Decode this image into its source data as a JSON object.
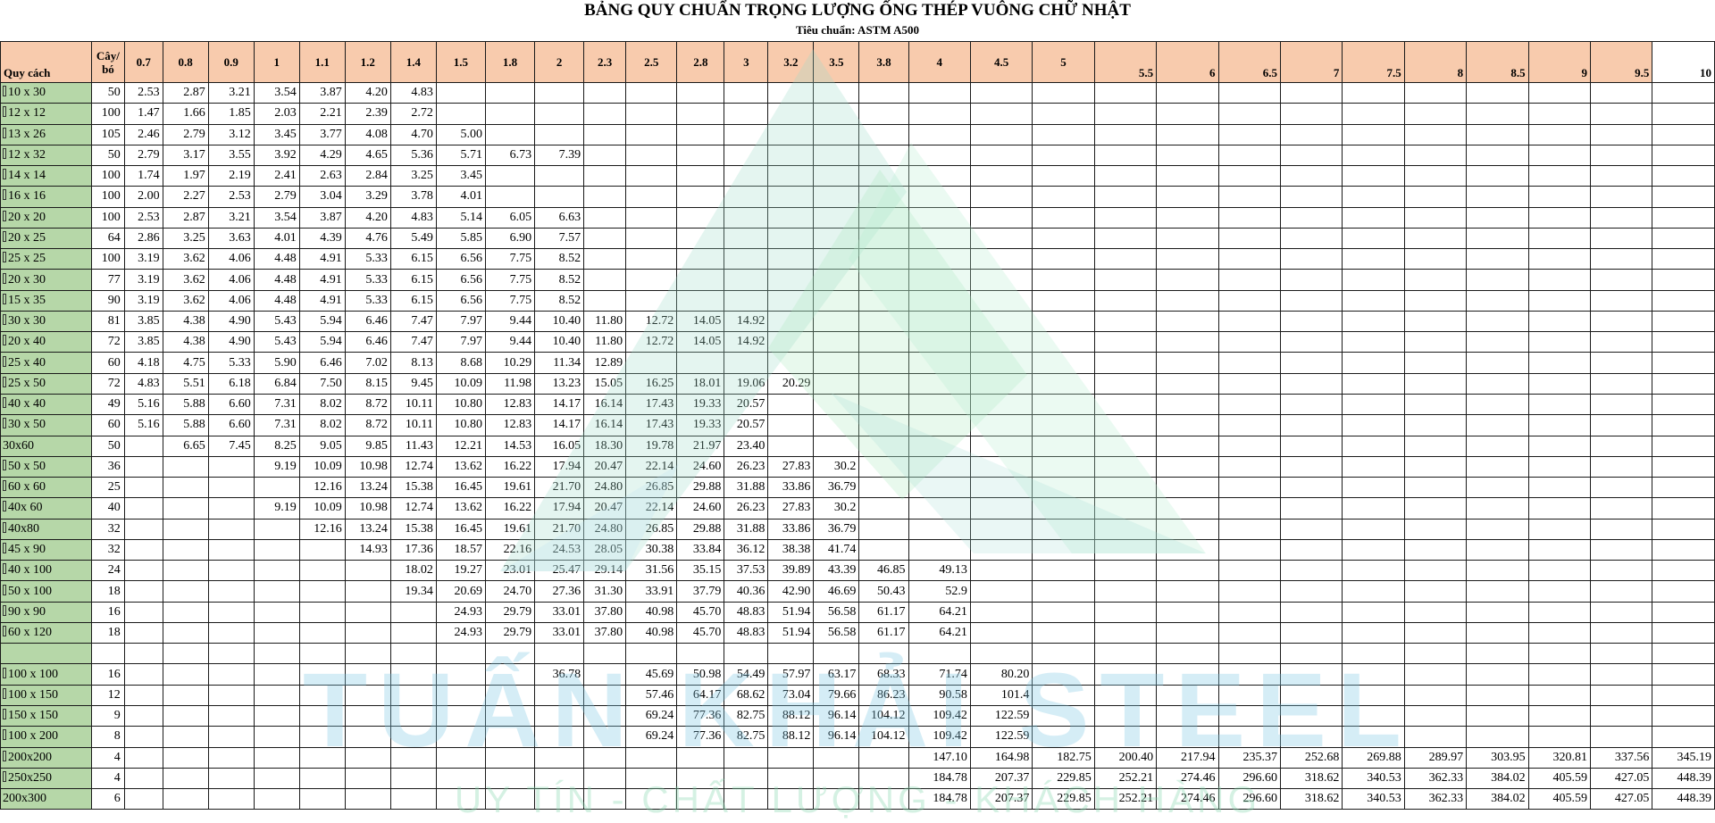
{
  "title": "BẢNG QUY CHUẨN TRỌNG LƯỢNG ỐNG THÉP VUÔNG CHỮ NHẬT",
  "subtitle": "Tiêu chuẩn: ASTM A500",
  "watermark": {
    "brand": "TUẤN KHẢI STEEL",
    "slogan": "UY TÍN - CHẤT LƯỢNG - KHÁCH HÀNG"
  },
  "colors": {
    "header_bg": "#f8cbad",
    "spec_bg": "#b6d7a8",
    "border": "#1a1a1a"
  },
  "header": {
    "spec_label": "Quy cách",
    "count_label": "Cây/ bó",
    "thicknesses": [
      "0.7",
      "0.8",
      "0.9",
      "1",
      "1.1",
      "1.2",
      "1.4",
      "1.5",
      "1.8",
      "2",
      "2.3",
      "2.5",
      "2.8",
      "3",
      "3.2",
      "3.5",
      "3.8",
      "4",
      "4.5",
      "5",
      "5.5",
      "6",
      "6.5",
      "7",
      "7.5",
      "8",
      "8.5",
      "9",
      "9.5",
      "10"
    ]
  },
  "rows": [
    {
      "spec": "10 x 30",
      "box": true,
      "count": "50",
      "values": [
        "2.53",
        "2.87",
        "3.21",
        "3.54",
        "3.87",
        "4.20",
        "4.83",
        "",
        "",
        "",
        "",
        "",
        "",
        "",
        "",
        "",
        "",
        "",
        "",
        "",
        "",
        "",
        "",
        "",
        "",
        "",
        "",
        "",
        "",
        ""
      ]
    },
    {
      "spec": "12 x 12",
      "box": true,
      "count": "100",
      "values": [
        "1.47",
        "1.66",
        "1.85",
        "2.03",
        "2.21",
        "2.39",
        "2.72",
        "",
        "",
        "",
        "",
        "",
        "",
        "",
        "",
        "",
        "",
        "",
        "",
        "",
        "",
        "",
        "",
        "",
        "",
        "",
        "",
        "",
        "",
        ""
      ]
    },
    {
      "spec": "13 x 26",
      "box": true,
      "count": "105",
      "values": [
        "2.46",
        "2.79",
        "3.12",
        "3.45",
        "3.77",
        "4.08",
        "4.70",
        "5.00",
        "",
        "",
        "",
        "",
        "",
        "",
        "",
        "",
        "",
        "",
        "",
        "",
        "",
        "",
        "",
        "",
        "",
        "",
        "",
        "",
        "",
        ""
      ]
    },
    {
      "spec": "12 x 32",
      "box": true,
      "count": "50",
      "values": [
        "2.79",
        "3.17",
        "3.55",
        "3.92",
        "4.29",
        "4.65",
        "5.36",
        "5.71",
        "6.73",
        "7.39",
        "",
        "",
        "",
        "",
        "",
        "",
        "",
        "",
        "",
        "",
        "",
        "",
        "",
        "",
        "",
        "",
        "",
        "",
        "",
        ""
      ]
    },
    {
      "spec": "14 x 14",
      "box": true,
      "count": "100",
      "values": [
        "1.74",
        "1.97",
        "2.19",
        "2.41",
        "2.63",
        "2.84",
        "3.25",
        "3.45",
        "",
        "",
        "",
        "",
        "",
        "",
        "",
        "",
        "",
        "",
        "",
        "",
        "",
        "",
        "",
        "",
        "",
        "",
        "",
        "",
        "",
        ""
      ]
    },
    {
      "spec": "16 x 16",
      "box": true,
      "count": "100",
      "values": [
        "2.00",
        "2.27",
        "2.53",
        "2.79",
        "3.04",
        "3.29",
        "3.78",
        "4.01",
        "",
        "",
        "",
        "",
        "",
        "",
        "",
        "",
        "",
        "",
        "",
        "",
        "",
        "",
        "",
        "",
        "",
        "",
        "",
        "",
        "",
        ""
      ]
    },
    {
      "spec": "20 x 20",
      "box": true,
      "count": "100",
      "values": [
        "2.53",
        "2.87",
        "3.21",
        "3.54",
        "3.87",
        "4.20",
        "4.83",
        "5.14",
        "6.05",
        "6.63",
        "",
        "",
        "",
        "",
        "",
        "",
        "",
        "",
        "",
        "",
        "",
        "",
        "",
        "",
        "",
        "",
        "",
        "",
        "",
        ""
      ]
    },
    {
      "spec": "20 x 25",
      "box": true,
      "count": "64",
      "values": [
        "2.86",
        "3.25",
        "3.63",
        "4.01",
        "4.39",
        "4.76",
        "5.49",
        "5.85",
        "6.90",
        "7.57",
        "",
        "",
        "",
        "",
        "",
        "",
        "",
        "",
        "",
        "",
        "",
        "",
        "",
        "",
        "",
        "",
        "",
        "",
        "",
        ""
      ]
    },
    {
      "spec": "25 x 25",
      "box": true,
      "count": "100",
      "values": [
        "3.19",
        "3.62",
        "4.06",
        "4.48",
        "4.91",
        "5.33",
        "6.15",
        "6.56",
        "7.75",
        "8.52",
        "",
        "",
        "",
        "",
        "",
        "",
        "",
        "",
        "",
        "",
        "",
        "",
        "",
        "",
        "",
        "",
        "",
        "",
        "",
        ""
      ]
    },
    {
      "spec": "20 x 30",
      "box": true,
      "count": "77",
      "values": [
        "3.19",
        "3.62",
        "4.06",
        "4.48",
        "4.91",
        "5.33",
        "6.15",
        "6.56",
        "7.75",
        "8.52",
        "",
        "",
        "",
        "",
        "",
        "",
        "",
        "",
        "",
        "",
        "",
        "",
        "",
        "",
        "",
        "",
        "",
        "",
        "",
        ""
      ]
    },
    {
      "spec": "15 x 35",
      "box": true,
      "count": "90",
      "values": [
        "3.19",
        "3.62",
        "4.06",
        "4.48",
        "4.91",
        "5.33",
        "6.15",
        "6.56",
        "7.75",
        "8.52",
        "",
        "",
        "",
        "",
        "",
        "",
        "",
        "",
        "",
        "",
        "",
        "",
        "",
        "",
        "",
        "",
        "",
        "",
        "",
        ""
      ]
    },
    {
      "spec": "30 x 30",
      "box": true,
      "count": "81",
      "values": [
        "3.85",
        "4.38",
        "4.90",
        "5.43",
        "5.94",
        "6.46",
        "7.47",
        "7.97",
        "9.44",
        "10.40",
        "11.80",
        "12.72",
        "14.05",
        "14.92",
        "",
        "",
        "",
        "",
        "",
        "",
        "",
        "",
        "",
        "",
        "",
        "",
        "",
        "",
        "",
        ""
      ]
    },
    {
      "spec": "20 x 40",
      "box": true,
      "count": "72",
      "values": [
        "3.85",
        "4.38",
        "4.90",
        "5.43",
        "5.94",
        "6.46",
        "7.47",
        "7.97",
        "9.44",
        "10.40",
        "11.80",
        "12.72",
        "14.05",
        "14.92",
        "",
        "",
        "",
        "",
        "",
        "",
        "",
        "",
        "",
        "",
        "",
        "",
        "",
        "",
        "",
        ""
      ]
    },
    {
      "spec": "25 x 40",
      "box": true,
      "count": "60",
      "values": [
        "4.18",
        "4.75",
        "5.33",
        "5.90",
        "6.46",
        "7.02",
        "8.13",
        "8.68",
        "10.29",
        "11.34",
        "12.89",
        "",
        "",
        "",
        "",
        "",
        "",
        "",
        "",
        "",
        "",
        "",
        "",
        "",
        "",
        "",
        "",
        "",
        "",
        ""
      ]
    },
    {
      "spec": "25 x 50",
      "box": true,
      "count": "72",
      "values": [
        "4.83",
        "5.51",
        "6.18",
        "6.84",
        "7.50",
        "8.15",
        "9.45",
        "10.09",
        "11.98",
        "13.23",
        "15.05",
        "16.25",
        "18.01",
        "19.06",
        "20.29",
        "",
        "",
        "",
        "",
        "",
        "",
        "",
        "",
        "",
        "",
        "",
        "",
        "",
        "",
        ""
      ]
    },
    {
      "spec": "40 x 40",
      "box": true,
      "count": "49",
      "values": [
        "5.16",
        "5.88",
        "6.60",
        "7.31",
        "8.02",
        "8.72",
        "10.11",
        "10.80",
        "12.83",
        "14.17",
        "16.14",
        "17.43",
        "19.33",
        "20.57",
        "",
        "",
        "",
        "",
        "",
        "",
        "",
        "",
        "",
        "",
        "",
        "",
        "",
        "",
        "",
        ""
      ]
    },
    {
      "spec": "30 x 50",
      "box": true,
      "count": "60",
      "values": [
        "5.16",
        "5.88",
        "6.60",
        "7.31",
        "8.02",
        "8.72",
        "10.11",
        "10.80",
        "12.83",
        "14.17",
        "16.14",
        "17.43",
        "19.33",
        "20.57",
        "",
        "",
        "",
        "",
        "",
        "",
        "",
        "",
        "",
        "",
        "",
        "",
        "",
        "",
        "",
        ""
      ]
    },
    {
      "spec": "30x60",
      "box": false,
      "count": "50",
      "values": [
        "",
        "6.65",
        "7.45",
        "8.25",
        "9.05",
        "9.85",
        "11.43",
        "12.21",
        "14.53",
        "16.05",
        "18.30",
        "19.78",
        "21.97",
        "23.40",
        "",
        "",
        "",
        "",
        "",
        "",
        "",
        "",
        "",
        "",
        "",
        "",
        "",
        "",
        "",
        ""
      ]
    },
    {
      "spec": "50 x 50",
      "box": true,
      "count": "36",
      "values": [
        "",
        "",
        "",
        "9.19",
        "10.09",
        "10.98",
        "12.74",
        "13.62",
        "16.22",
        "17.94",
        "20.47",
        "22.14",
        "24.60",
        "26.23",
        "27.83",
        "30.2",
        "",
        "",
        "",
        "",
        "",
        "",
        "",
        "",
        "",
        "",
        "",
        "",
        "",
        ""
      ]
    },
    {
      "spec": "60 x 60",
      "box": true,
      "count": "25",
      "values": [
        "",
        "",
        "",
        "",
        "12.16",
        "13.24",
        "15.38",
        "16.45",
        "19.61",
        "21.70",
        "24.80",
        "26.85",
        "29.88",
        "31.88",
        "33.86",
        "36.79",
        "",
        "",
        "",
        "",
        "",
        "",
        "",
        "",
        "",
        "",
        "",
        "",
        "",
        ""
      ]
    },
    {
      "spec": "40x 60",
      "box": true,
      "count": "40",
      "values": [
        "",
        "",
        "",
        "9.19",
        "10.09",
        "10.98",
        "12.74",
        "13.62",
        "16.22",
        "17.94",
        "20.47",
        "22.14",
        "24.60",
        "26.23",
        "27.83",
        "30.2",
        "",
        "",
        "",
        "",
        "",
        "",
        "",
        "",
        "",
        "",
        "",
        "",
        "",
        ""
      ]
    },
    {
      "spec": "40x80",
      "box": true,
      "count": "32",
      "values": [
        "",
        "",
        "",
        "",
        "12.16",
        "13.24",
        "15.38",
        "16.45",
        "19.61",
        "21.70",
        "24.80",
        "26.85",
        "29.88",
        "31.88",
        "33.86",
        "36.79",
        "",
        "",
        "",
        "",
        "",
        "",
        "",
        "",
        "",
        "",
        "",
        "",
        "",
        ""
      ]
    },
    {
      "spec": "45 x 90",
      "box": true,
      "count": "32",
      "values": [
        "",
        "",
        "",
        "",
        "",
        "14.93",
        "17.36",
        "18.57",
        "22.16",
        "24.53",
        "28.05",
        "30.38",
        "33.84",
        "36.12",
        "38.38",
        "41.74",
        "",
        "",
        "",
        "",
        "",
        "",
        "",
        "",
        "",
        "",
        "",
        "",
        "",
        ""
      ]
    },
    {
      "spec": "40 x 100",
      "box": true,
      "count": "24",
      "values": [
        "",
        "",
        "",
        "",
        "",
        "",
        "18.02",
        "19.27",
        "23.01",
        "25.47",
        "29.14",
        "31.56",
        "35.15",
        "37.53",
        "39.89",
        "43.39",
        "46.85",
        "49.13",
        "",
        "",
        "",
        "",
        "",
        "",
        "",
        "",
        "",
        "",
        "",
        ""
      ]
    },
    {
      "spec": "50 x 100",
      "box": true,
      "count": "18",
      "values": [
        "",
        "",
        "",
        "",
        "",
        "",
        "19.34",
        "20.69",
        "24.70",
        "27.36",
        "31.30",
        "33.91",
        "37.79",
        "40.36",
        "42.90",
        "46.69",
        "50.43",
        "52.9",
        "",
        "",
        "",
        "",
        "",
        "",
        "",
        "",
        "",
        "",
        "",
        ""
      ]
    },
    {
      "spec": "90 x 90",
      "box": true,
      "count": "16",
      "values": [
        "",
        "",
        "",
        "",
        "",
        "",
        "",
        "24.93",
        "29.79",
        "33.01",
        "37.80",
        "40.98",
        "45.70",
        "48.83",
        "51.94",
        "56.58",
        "61.17",
        "64.21",
        "",
        "",
        "",
        "",
        "",
        "",
        "",
        "",
        "",
        "",
        "",
        ""
      ]
    },
    {
      "spec": "60 x 120",
      "box": true,
      "count": "18",
      "values": [
        "",
        "",
        "",
        "",
        "",
        "",
        "",
        "24.93",
        "29.79",
        "33.01",
        "37.80",
        "40.98",
        "45.70",
        "48.83",
        "51.94",
        "56.58",
        "61.17",
        "64.21",
        "",
        "",
        "",
        "",
        "",
        "",
        "",
        "",
        "",
        "",
        "",
        ""
      ]
    },
    {
      "spec": "",
      "box": false,
      "count": "",
      "values": [
        "",
        "",
        "",
        "",
        "",
        "",
        "",
        "",
        "",
        "",
        "",
        "",
        "",
        "",
        "",
        "",
        "",
        "",
        "",
        "",
        "",
        "",
        "",
        "",
        "",
        "",
        "",
        "",
        "",
        ""
      ]
    },
    {
      "spec": "100 x 100",
      "box": true,
      "count": "16",
      "values": [
        "",
        "",
        "",
        "",
        "",
        "",
        "",
        "",
        "",
        "36.78",
        "",
        "45.69",
        "50.98",
        "54.49",
        "57.97",
        "63.17",
        "68.33",
        "71.74",
        "80.20",
        "",
        "",
        "",
        "",
        "",
        "",
        "",
        "",
        "",
        "",
        ""
      ]
    },
    {
      "spec": "100 x 150",
      "box": true,
      "count": "12",
      "values": [
        "",
        "",
        "",
        "",
        "",
        "",
        "",
        "",
        "",
        "",
        "",
        "57.46",
        "64.17",
        "68.62",
        "73.04",
        "79.66",
        "86.23",
        "90.58",
        "101.4",
        "",
        "",
        "",
        "",
        "",
        "",
        "",
        "",
        "",
        "",
        ""
      ]
    },
    {
      "spec": "150 x 150",
      "box": true,
      "count": "9",
      "values": [
        "",
        "",
        "",
        "",
        "",
        "",
        "",
        "",
        "",
        "",
        "",
        "69.24",
        "77.36",
        "82.75",
        "88.12",
        "96.14",
        "104.12",
        "109.42",
        "122.59",
        "",
        "",
        "",
        "",
        "",
        "",
        "",
        "",
        "",
        "",
        ""
      ]
    },
    {
      "spec": "100 x 200",
      "box": true,
      "count": "8",
      "values": [
        "",
        "",
        "",
        "",
        "",
        "",
        "",
        "",
        "",
        "",
        "",
        "69.24",
        "77.36",
        "82.75",
        "88.12",
        "96.14",
        "104.12",
        "109.42",
        "122.59",
        "",
        "",
        "",
        "",
        "",
        "",
        "",
        "",
        "",
        "",
        ""
      ]
    },
    {
      "spec": "200x200",
      "box": true,
      "count": "4",
      "values": [
        "",
        "",
        "",
        "",
        "",
        "",
        "",
        "",
        "",
        "",
        "",
        "",
        "",
        "",
        "",
        "",
        "",
        "147.10",
        "164.98",
        "182.75",
        "200.40",
        "217.94",
        "235.37",
        "252.68",
        "269.88",
        "289.97",
        "303.95",
        "320.81",
        "337.56",
        "345.19"
      ]
    },
    {
      "spec": "250x250",
      "box": true,
      "count": "4",
      "values": [
        "",
        "",
        "",
        "",
        "",
        "",
        "",
        "",
        "",
        "",
        "",
        "",
        "",
        "",
        "",
        "",
        "",
        "184.78",
        "207.37",
        "229.85",
        "252.21",
        "274.46",
        "296.60",
        "318.62",
        "340.53",
        "362.33",
        "384.02",
        "405.59",
        "427.05",
        "448.39"
      ]
    },
    {
      "spec": "200x300",
      "box": false,
      "count": "6",
      "values": [
        "",
        "",
        "",
        "",
        "",
        "",
        "",
        "",
        "",
        "",
        "",
        "",
        "",
        "",
        "",
        "",
        "",
        "184.78",
        "207.37",
        "229.85",
        "252.21",
        "274.46",
        "296.60",
        "318.62",
        "340.53",
        "362.33",
        "384.02",
        "405.59",
        "427.05",
        "448.39"
      ]
    }
  ]
}
